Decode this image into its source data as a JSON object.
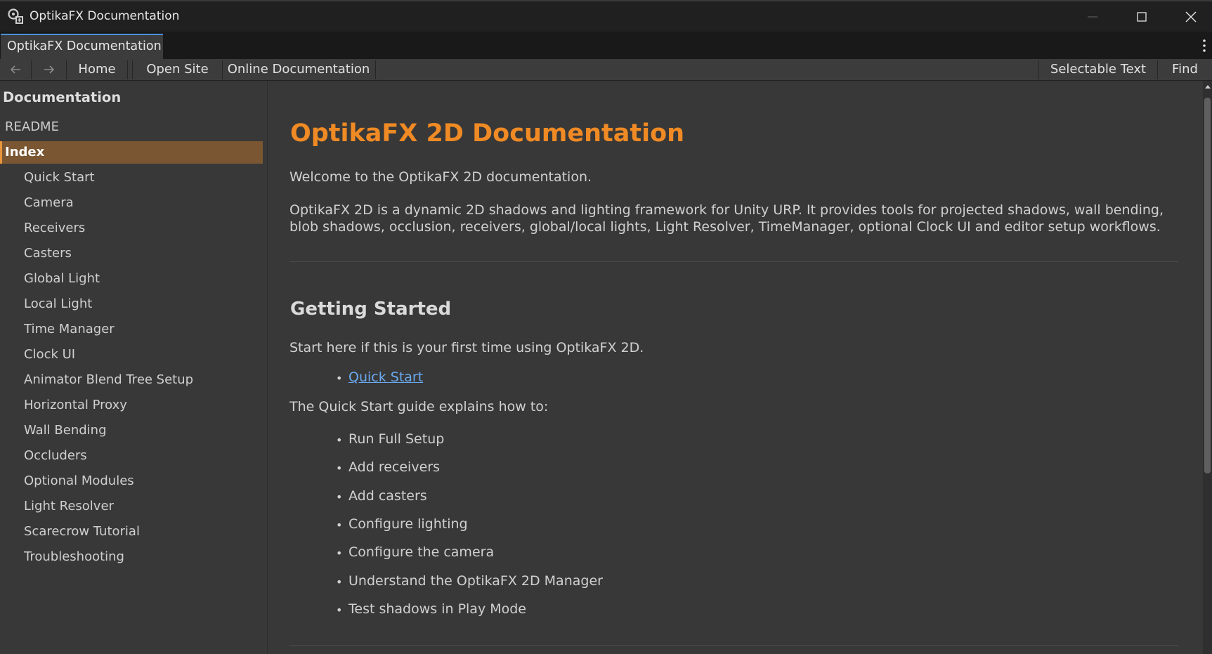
{
  "window": {
    "title": "OptikaFX Documentation"
  },
  "tab": {
    "label": "OptikaFX Documentation"
  },
  "toolbar": {
    "home": "Home",
    "open_site": "Open Site",
    "online_docs": "Online Documentation",
    "selectable_text": "Selectable Text",
    "find": "Find"
  },
  "sidebar": {
    "header": "Documentation",
    "items": [
      {
        "label": "README",
        "level": 0,
        "active": false
      },
      {
        "label": "Index",
        "level": 0,
        "active": true
      },
      {
        "label": "Quick Start",
        "level": 1,
        "active": false
      },
      {
        "label": "Camera",
        "level": 1,
        "active": false
      },
      {
        "label": "Receivers",
        "level": 1,
        "active": false
      },
      {
        "label": "Casters",
        "level": 1,
        "active": false
      },
      {
        "label": "Global Light",
        "level": 1,
        "active": false
      },
      {
        "label": "Local Light",
        "level": 1,
        "active": false
      },
      {
        "label": "Time Manager",
        "level": 1,
        "active": false
      },
      {
        "label": "Clock UI",
        "level": 1,
        "active": false
      },
      {
        "label": "Animator Blend Tree Setup",
        "level": 1,
        "active": false
      },
      {
        "label": "Horizontal Proxy",
        "level": 1,
        "active": false
      },
      {
        "label": "Wall Bending",
        "level": 1,
        "active": false
      },
      {
        "label": "Occluders",
        "level": 1,
        "active": false
      },
      {
        "label": "Optional Modules",
        "level": 1,
        "active": false
      },
      {
        "label": "Light Resolver",
        "level": 1,
        "active": false
      },
      {
        "label": "Scarecrow Tutorial",
        "level": 1,
        "active": false
      },
      {
        "label": "Troubleshooting",
        "level": 1,
        "active": false
      }
    ]
  },
  "content": {
    "title": "OptikaFX 2D Documentation",
    "welcome": "Welcome to the OptikaFX 2D documentation.",
    "description_line1": "OptikaFX 2D is a dynamic 2D shadows and lighting framework for Unity URP. It provides tools for projected shadows, wall bending,",
    "description_line2": "blob shadows, occlusion, receivers, global/local lights, Light Resolver, TimeManager, optional Clock UI and editor setup workflows.",
    "getting_started": {
      "heading": "Getting Started",
      "intro": "Start here if this is your first time using OptikaFX 2D.",
      "link": "Quick Start",
      "explains": "The Quick Start guide explains how to:",
      "steps": [
        "Run Full Setup",
        "Add receivers",
        "Add casters",
        "Configure lighting",
        "Configure the camera",
        "Understand the OptikaFX 2D Manager",
        "Test shadows in Play Mode"
      ]
    }
  },
  "icons": {
    "app": "unity-logo-icon",
    "back": "arrow-left-icon",
    "forward": "arrow-right-icon",
    "minimize": "minimize-icon",
    "maximize": "maximize-icon",
    "close": "close-icon",
    "menu": "kebab-menu-icon"
  },
  "colors": {
    "accent": "#f08a24",
    "active_item_bg": "#7a5632",
    "link": "#6aaaf0"
  }
}
